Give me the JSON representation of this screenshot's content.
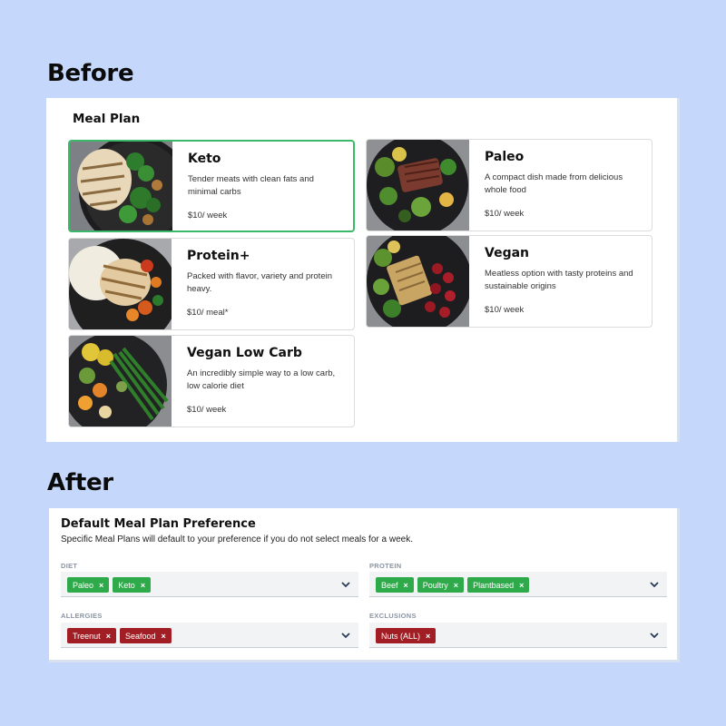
{
  "headings": {
    "before": "Before",
    "after": "After"
  },
  "meal_plan": {
    "title": "Meal Plan",
    "cards": [
      {
        "title": "Keto",
        "description": "Tender meats with clean fats and minimal carbs",
        "price": "$10/ week"
      },
      {
        "title": "Protein+",
        "description": "Packed with flavor, variety and protein heavy.",
        "price": "$10/ meal*"
      },
      {
        "title": "Vegan Low Carb",
        "description": "An incredibly simple way to a low carb, low calorie diet",
        "price": "$10/ week"
      },
      {
        "title": "Paleo",
        "description": "A compact dish made from delicious whole food",
        "price": "$10/ week"
      },
      {
        "title": "Vegan",
        "description": "Meatless option with tasty proteins and sustainable origins",
        "price": "$10/ week"
      }
    ]
  },
  "preference": {
    "title": "Default Meal Plan Preference",
    "subtitle": "Specific Meal Plans will default to your preference if you do not select meals for a week.",
    "fields": {
      "diet": {
        "label": "DIET",
        "tags": [
          "Paleo",
          "Keto"
        ]
      },
      "protein": {
        "label": "PROTEIN",
        "tags": [
          "Beef",
          "Poultry",
          "Plantbased"
        ]
      },
      "allergies": {
        "label": "ALLERGIES",
        "tags": [
          "Treenut",
          "Seafood"
        ]
      },
      "exclusions": {
        "label": "EXCLUSIONS",
        "tags": [
          "Nuts (ALL)"
        ]
      }
    },
    "remove_symbol": "×"
  },
  "colors": {
    "background": "#c5d8fb",
    "selected_border": "#3cb86a",
    "tag_green": "#2eaa4a",
    "tag_red": "#a11f24"
  },
  "icons": {
    "dropdown": "chevron-down-icon",
    "remove": "close-icon"
  }
}
